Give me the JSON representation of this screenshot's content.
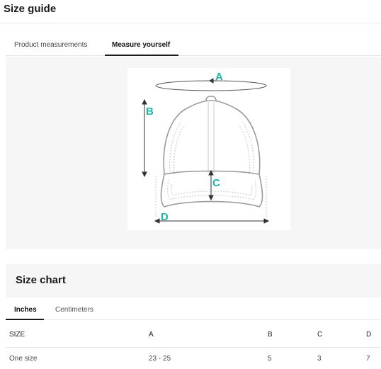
{
  "page": {
    "title": "Size guide"
  },
  "tabs": [
    {
      "label": "Product measurements",
      "active": false
    },
    {
      "label": "Measure yourself",
      "active": true
    }
  ],
  "illustration": {
    "icon": "baseball-cap-measurement-diagram",
    "labels": {
      "a": "A",
      "b": "B",
      "c": "C",
      "d": "D"
    },
    "accent_color": "#1fb5a6",
    "line_color": "#9a9a9a"
  },
  "size_chart": {
    "title": "Size chart",
    "unit_tabs": [
      {
        "label": "Inches",
        "active": true
      },
      {
        "label": "Centimeters",
        "active": false
      }
    ],
    "columns": [
      "SIZE",
      "A",
      "B",
      "C",
      "D"
    ],
    "rows": [
      [
        "One size",
        "23 - 25",
        "5",
        "3",
        "7"
      ]
    ]
  }
}
